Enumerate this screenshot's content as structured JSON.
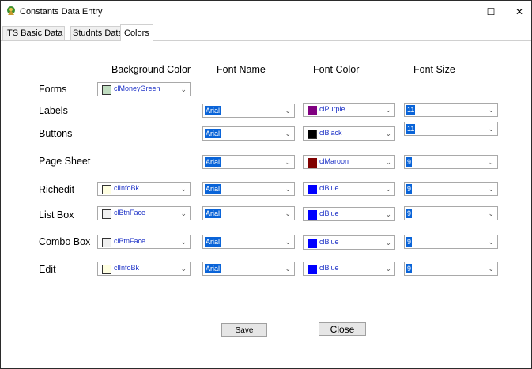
{
  "window": {
    "title": "Constants Data Entry",
    "minimize": "–",
    "maximize": "☐",
    "close": "✕"
  },
  "tabs": [
    {
      "label": "ITS Basic Data"
    },
    {
      "label": "Studnts Data"
    },
    {
      "label": "Colors"
    }
  ],
  "columns": {
    "background": "Background Color",
    "font_name": "Font Name",
    "font_color": "Font Color",
    "font_size": "Font Size"
  },
  "rows": [
    {
      "label": "Forms",
      "bg": "clMoneyGreen",
      "bg_hex": "#c0dcc0"
    },
    {
      "label": "Labels",
      "font": "Arial",
      "fcolor": "clPurple",
      "fcolor_hex": "#800080",
      "size": "11"
    },
    {
      "label": "Buttons",
      "font": "Arial",
      "fcolor": "clBlack",
      "fcolor_hex": "#000000",
      "size": "11"
    },
    {
      "label": "Page Sheet",
      "font": "Arial",
      "fcolor": "clMaroon",
      "fcolor_hex": "#800000",
      "size": "9"
    },
    {
      "label": "Richedit",
      "bg": "clInfoBk",
      "bg_hex": "#ffffe1",
      "font": "Arial",
      "fcolor": "clBlue",
      "fcolor_hex": "#0000ff",
      "size": "9"
    },
    {
      "label": "List Box",
      "bg": "clBtnFace",
      "bg_hex": "#f0f0f0",
      "font": "Arial",
      "fcolor": "clBlue",
      "fcolor_hex": "#0000ff",
      "size": "9"
    },
    {
      "label": "Combo Box",
      "bg": "clBtnFace",
      "bg_hex": "#f0f0f0",
      "font": "Arial",
      "fcolor": "clBlue",
      "fcolor_hex": "#0000ff",
      "size": "9"
    },
    {
      "label": "Edit",
      "bg": "clInfoBk",
      "bg_hex": "#ffffe1",
      "font": "Arial",
      "fcolor": "clBlue",
      "fcolor_hex": "#0000ff",
      "size": "9"
    }
  ],
  "buttons": {
    "save": "Save",
    "close": "Close"
  },
  "icons": {
    "chevron": "chevron-down-icon",
    "app": "app-icon"
  }
}
